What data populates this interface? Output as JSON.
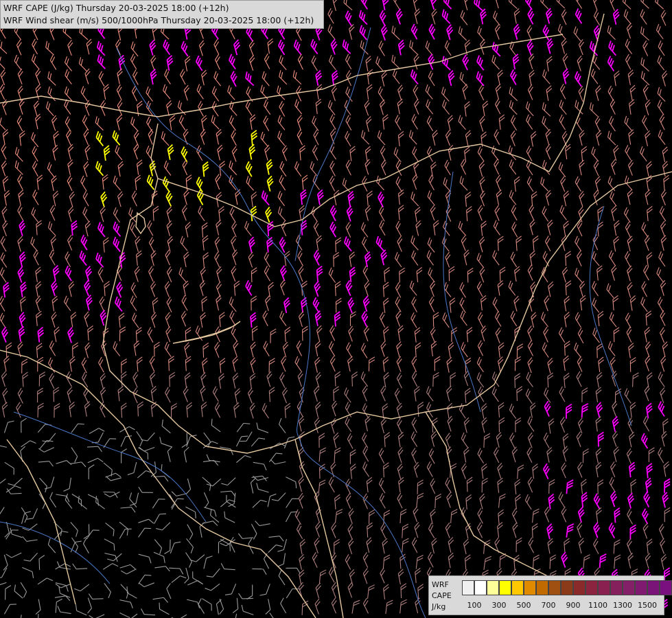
{
  "title": {
    "line1": "WRF CAPE (J/kg) Thursday 20-03-2025 18:00 (+12h)",
    "line2": "WRF Wind shear (m/s) 500/1000hPa Thursday 20-03-2025 18:00 (+12h)"
  },
  "legend": {
    "label_model": "WRF",
    "label_var": "CAPE",
    "label_unit": "J/kg",
    "tick_labels": [
      "100",
      "300",
      "500",
      "700",
      "900",
      "1100",
      "1300",
      "1500"
    ],
    "colors": [
      "#f0f0f0",
      "#ffffff",
      "#ffff99",
      "#ffff00",
      "#ffc800",
      "#e08a00",
      "#c06a00",
      "#a05010",
      "#8b3a1a",
      "#8a2a2a",
      "#8c2440",
      "#8a2050",
      "#86205c",
      "#842068",
      "#801a70",
      "#7a1478",
      "#7a1080"
    ]
  },
  "map": {
    "background": "#000000",
    "border_color": "#e6c8a0",
    "river_color": "#4a78c8",
    "barb_colors": {
      "low": "#9a9a9a",
      "mid_low": "#b08080",
      "mid": "#d88a80",
      "mid_high": "#f09080",
      "high": "#ff00ff",
      "cape": "#ffff00"
    }
  }
}
